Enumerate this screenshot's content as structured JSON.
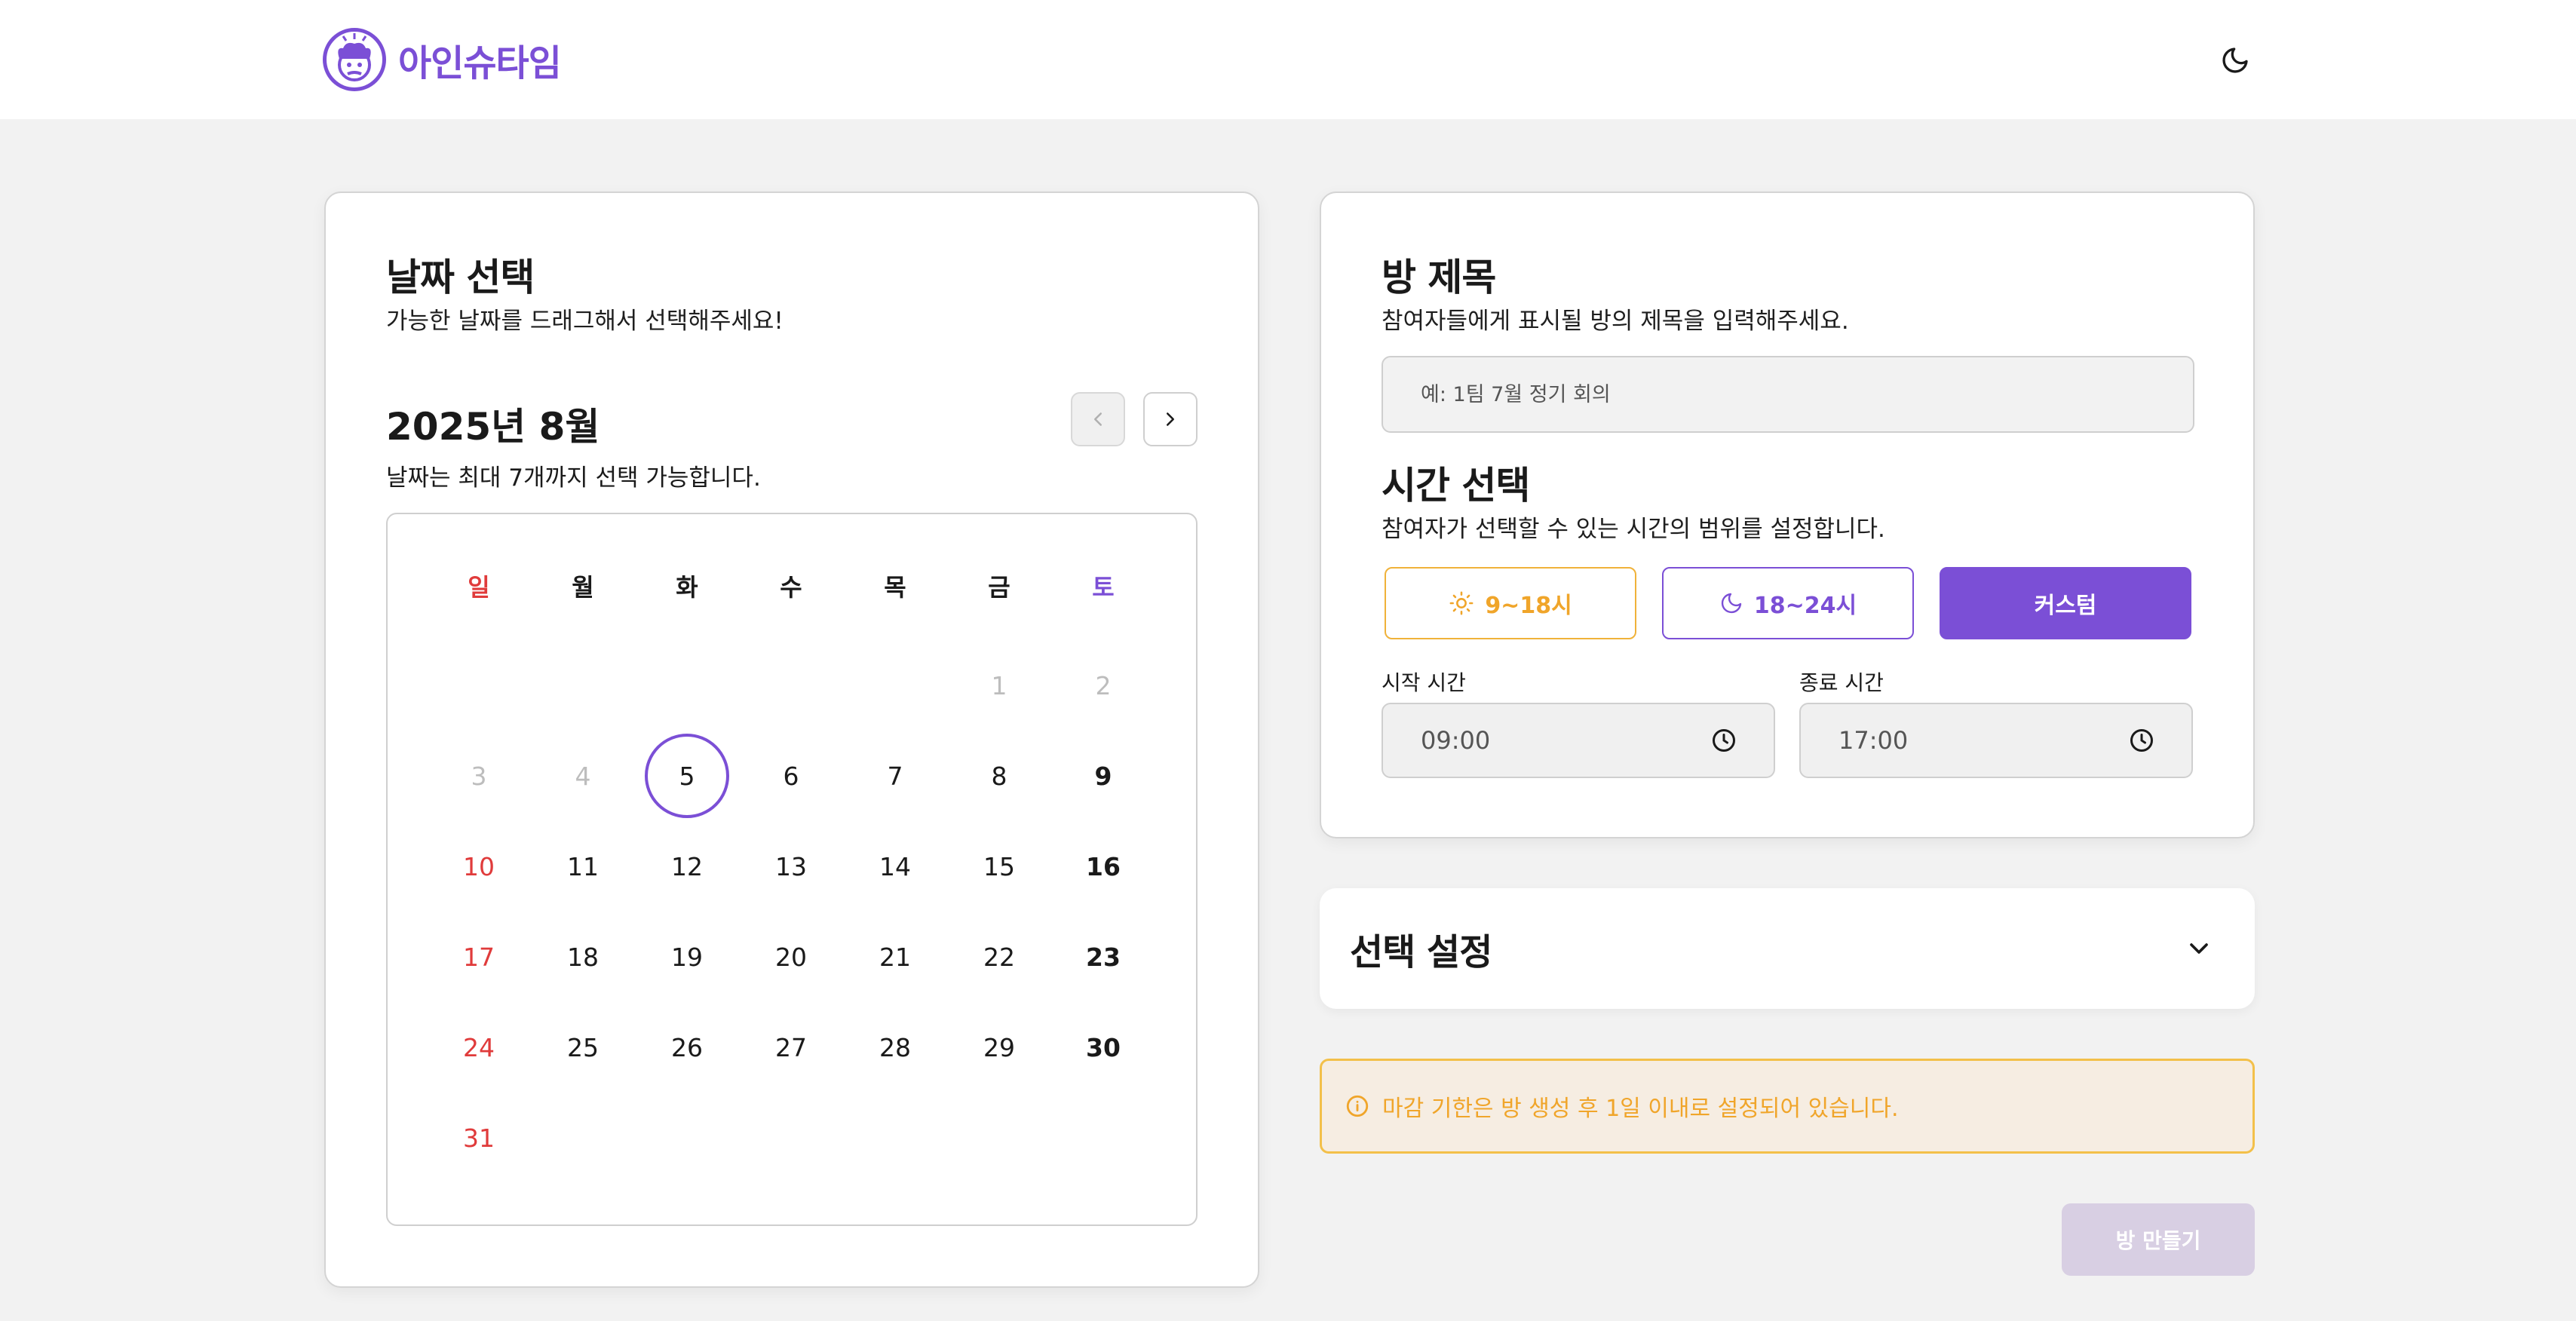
{
  "header": {
    "app_name": "아인슈타임",
    "theme_icon": "moon-icon"
  },
  "colors": {
    "accent": "#7b4fd6",
    "sunday": "#e03b3b",
    "warning": "#f0a52a",
    "warning_bg": "#f6ede2"
  },
  "calendar": {
    "title": "날짜 선택",
    "subtitle": "가능한 날짜를 드래그해서 선택해주세요!",
    "month_label": "2025년 8월",
    "limit_note": "날짜는 최대 7개까지 선택 가능합니다.",
    "prev_icon": "chevron-left-icon",
    "next_icon": "chevron-right-icon",
    "weekdays": [
      "일",
      "월",
      "화",
      "수",
      "목",
      "금",
      "토"
    ],
    "weeks": [
      [
        "",
        "",
        "",
        "",
        "",
        "1",
        "2"
      ],
      [
        "3",
        "4",
        "5",
        "6",
        "7",
        "8",
        "9"
      ],
      [
        "10",
        "11",
        "12",
        "13",
        "14",
        "15",
        "16"
      ],
      [
        "17",
        "18",
        "19",
        "20",
        "21",
        "22",
        "23"
      ],
      [
        "24",
        "25",
        "26",
        "27",
        "28",
        "29",
        "30"
      ],
      [
        "31",
        "",
        "",
        "",
        "",
        "",
        ""
      ]
    ],
    "past_days": [
      "1",
      "2",
      "3",
      "4"
    ],
    "today": "5"
  },
  "room": {
    "title": "방 제목",
    "subtitle": "참여자들에게 표시될 방의 제목을 입력해주세요.",
    "input_placeholder": "예: 1팀 7월 정기 회의",
    "input_value": ""
  },
  "time": {
    "title": "시간 선택",
    "subtitle": "참여자가 선택할 수 있는 시간의 범위를 설정합니다.",
    "presets": [
      {
        "label": "9~18시",
        "icon": "sun-icon"
      },
      {
        "label": "18~24시",
        "icon": "moon-icon"
      },
      {
        "label": "커스텀",
        "icon": ""
      }
    ],
    "start_label": "시작 시간",
    "start_value": "09:00",
    "end_label": "종료 시간",
    "end_value": "17:00",
    "clock_icon": "clock-icon"
  },
  "settings": {
    "title": "선택 설정",
    "icon": "chevron-down-icon"
  },
  "notice": {
    "icon": "info-icon",
    "text": "마감 기한은 방 생성 후 1일 이내로 설정되어 있습니다."
  },
  "create_button": "방 만들기"
}
